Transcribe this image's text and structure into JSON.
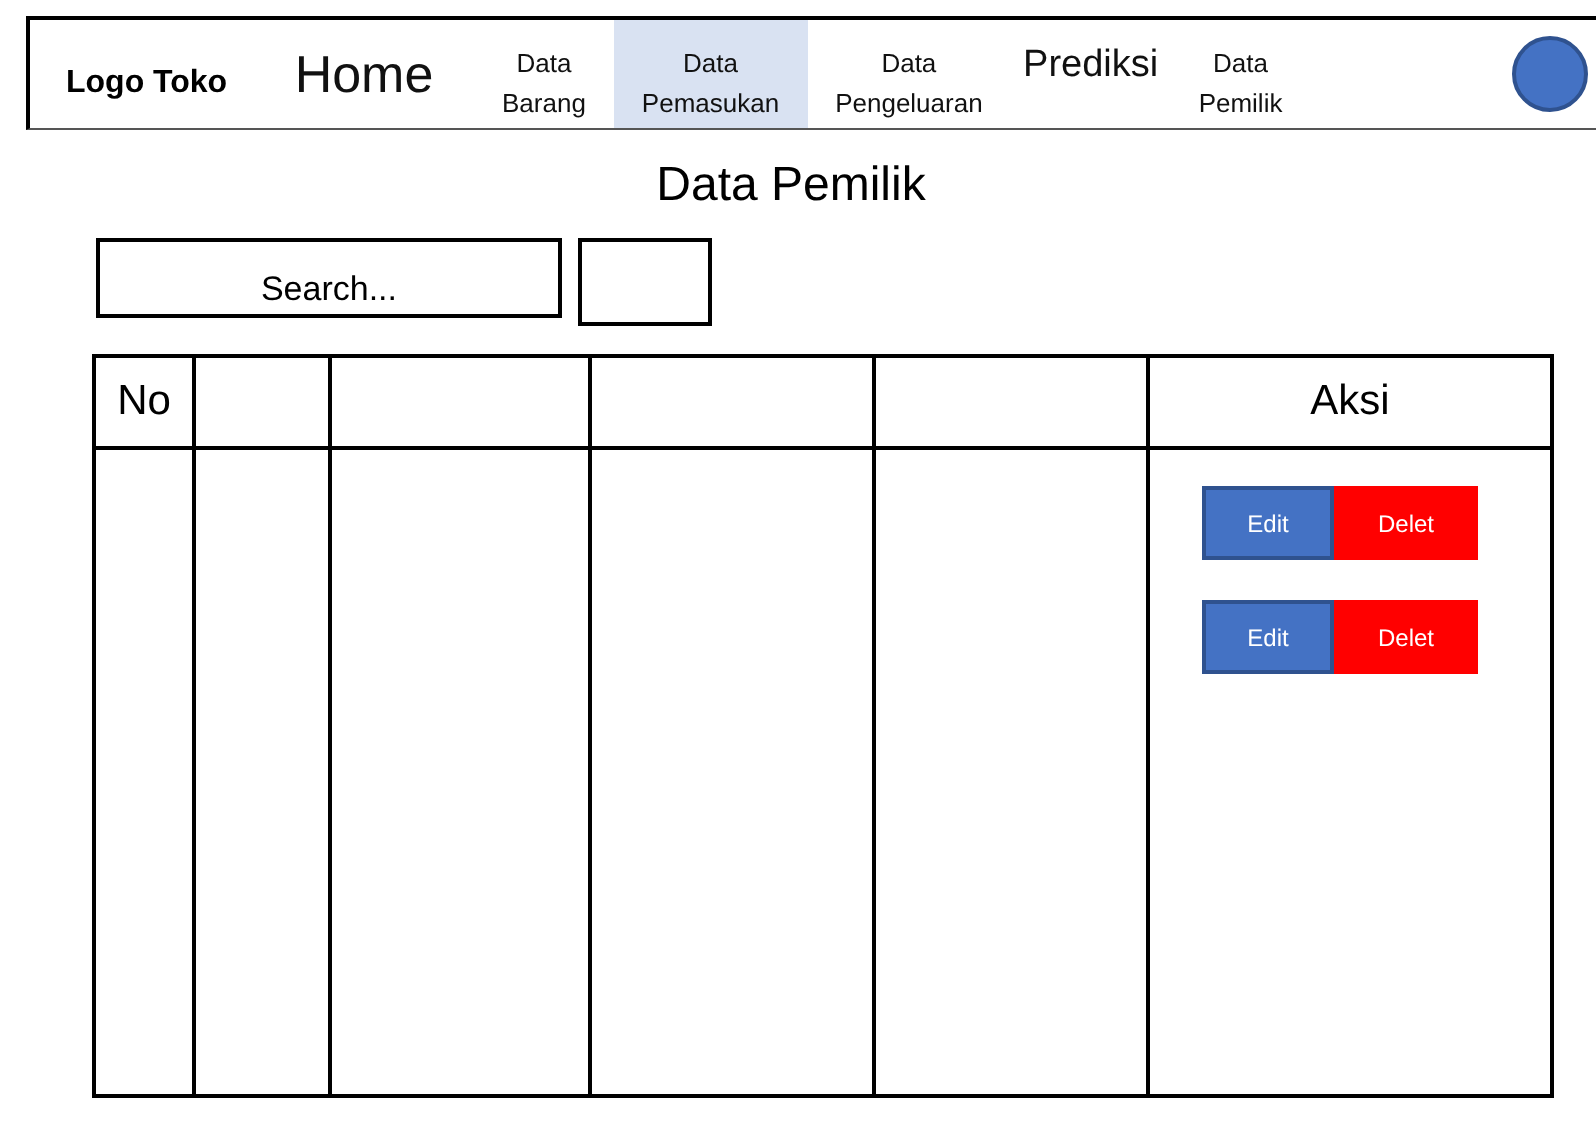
{
  "nav": {
    "logo": "Logo Toko",
    "items": [
      {
        "label": "Home",
        "kind": "large",
        "selected": false
      },
      {
        "label": "Data Barang",
        "kind": "small",
        "selected": false
      },
      {
        "label": "Data Pemasukan",
        "kind": "small",
        "selected": true
      },
      {
        "label": "Data Pengeluaran",
        "kind": "small",
        "selected": false
      },
      {
        "label": "Prediksi",
        "kind": "medium",
        "selected": false
      },
      {
        "label": "Data Pemilik",
        "kind": "small",
        "selected": false
      }
    ]
  },
  "page_title": "Data Pemilik",
  "search": {
    "placeholder": "Search..."
  },
  "table": {
    "columns": [
      "No",
      "",
      "",
      "",
      "",
      "Aksi"
    ],
    "rows": [
      {
        "actions": [
          "Edit",
          "Delet"
        ]
      },
      {
        "actions": [
          "Edit",
          "Delet"
        ]
      }
    ]
  }
}
